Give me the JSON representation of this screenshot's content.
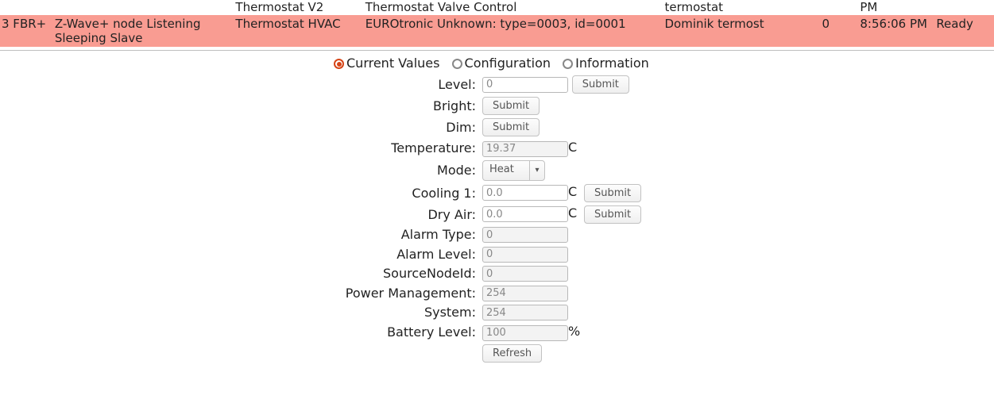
{
  "nodes": {
    "partial_row": {
      "category": "Thermostat V2",
      "product": "Thermostat Valve Control",
      "name": "termostat",
      "time": "PM"
    },
    "selected_row": {
      "id": "3 FBR+",
      "type": "Z-Wave+ node Listening Sleeping Slave",
      "category": "Thermostat HVAC",
      "product": "EUROtronic Unknown: type=0003, id=0001",
      "name": "Dominik termost",
      "num": "0",
      "time": "8:56:06 PM",
      "state": "Ready"
    }
  },
  "tabs": {
    "current": "Current Values",
    "config": "Configuration",
    "info": "Information",
    "selected": "current"
  },
  "form": {
    "level": {
      "label": "Level:",
      "value": "0",
      "submit": "Submit"
    },
    "bright": {
      "label": "Bright:",
      "submit": "Submit"
    },
    "dim": {
      "label": "Dim:",
      "submit": "Submit"
    },
    "temperature": {
      "label": "Temperature:",
      "value": "19.37",
      "unit": "C"
    },
    "mode": {
      "label": "Mode:",
      "value": "Heat"
    },
    "cooling1": {
      "label": "Cooling 1:",
      "value": "0.0",
      "unit": "C",
      "submit": "Submit"
    },
    "dryair": {
      "label": "Dry Air:",
      "value": "0.0",
      "unit": "C",
      "submit": "Submit"
    },
    "alarm_type": {
      "label": "Alarm Type:",
      "value": "0"
    },
    "alarm_level": {
      "label": "Alarm Level:",
      "value": "0"
    },
    "source_node": {
      "label": "SourceNodeId:",
      "value": "0"
    },
    "power_mgmt": {
      "label": "Power Management:",
      "value": "254"
    },
    "system": {
      "label": "System:",
      "value": "254"
    },
    "battery": {
      "label": "Battery Level:",
      "value": "100",
      "unit": "%"
    }
  },
  "buttons": {
    "refresh": "Refresh"
  }
}
